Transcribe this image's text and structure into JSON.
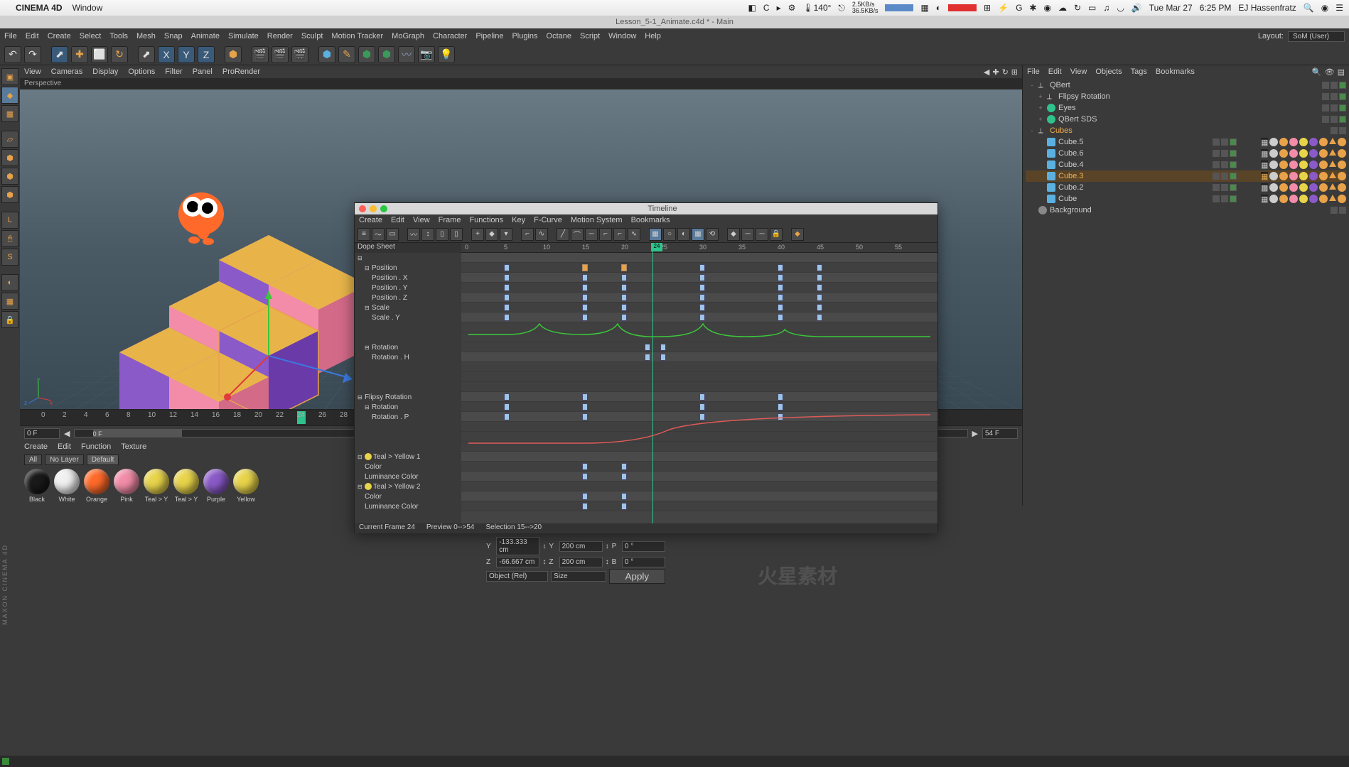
{
  "mac": {
    "app": "CINEMA 4D",
    "menu": "Window",
    "net_up": "2.5KB/s",
    "net_dn": "36.5KB/s",
    "temp": "140°",
    "date": "Tue Mar 27",
    "time": "6:25 PM",
    "user": "EJ Hassenfratz"
  },
  "titlebar": "Lesson_5-1_Animate.c4d * - Main",
  "main_menu": [
    "File",
    "Edit",
    "Create",
    "Select",
    "Tools",
    "Mesh",
    "Snap",
    "Animate",
    "Simulate",
    "Render",
    "Sculpt",
    "Motion Tracker",
    "MoGraph",
    "Character",
    "Pipeline",
    "Plugins",
    "Octane",
    "Script",
    "Window",
    "Help"
  ],
  "layout": {
    "label": "Layout:",
    "value": "SoM (User)"
  },
  "vp_menu": [
    "View",
    "Cameras",
    "Display",
    "Options",
    "Filter",
    "Panel",
    "ProRender"
  ],
  "vp_label": "Perspective",
  "om_menu": [
    "File",
    "Edit",
    "View",
    "Objects",
    "Tags",
    "Bookmarks"
  ],
  "objects": [
    {
      "name": "QBert",
      "lvl": 0,
      "icon": "null",
      "exp": "-"
    },
    {
      "name": "Flipsy Rotation",
      "lvl": 1,
      "icon": "null",
      "exp": "+"
    },
    {
      "name": "Eyes",
      "lvl": 1,
      "icon": "sphere",
      "exp": "+",
      "color": "#2fc28c"
    },
    {
      "name": "QBert SDS",
      "lvl": 1,
      "icon": "sds",
      "exp": "+",
      "color": "#2fc28c"
    },
    {
      "name": "Cubes",
      "lvl": 0,
      "icon": "null",
      "exp": "-",
      "sel": false,
      "hl": true
    },
    {
      "name": "Cube.5",
      "lvl": 1,
      "icon": "cube",
      "tags": true
    },
    {
      "name": "Cube.6",
      "lvl": 1,
      "icon": "cube",
      "tags": true
    },
    {
      "name": "Cube.4",
      "lvl": 1,
      "icon": "cube",
      "tags": true
    },
    {
      "name": "Cube.3",
      "lvl": 1,
      "icon": "cube",
      "tags": true,
      "sel": true
    },
    {
      "name": "Cube.2",
      "lvl": 1,
      "icon": "cube",
      "tags": true
    },
    {
      "name": "Cube",
      "lvl": 1,
      "icon": "cube",
      "tags": true
    },
    {
      "name": "Background",
      "lvl": 0,
      "icon": "bg"
    }
  ],
  "tag_colors": [
    "#ccc",
    "#e8a24a",
    "#f28ca8",
    "#e8d44a",
    "#8a5ac8",
    "#e8a24a"
  ],
  "timeline_ruler": [
    0,
    2,
    4,
    6,
    8,
    10,
    12,
    14,
    16,
    18,
    20,
    22,
    24,
    26,
    28
  ],
  "timeline_marker": 24,
  "frame_start": "0 F",
  "frame_mid": "0 F",
  "frame_end": "54 F",
  "mat_menu": [
    "Create",
    "Edit",
    "Function",
    "Texture"
  ],
  "mat_btns": [
    "All",
    "No Layer",
    "Default"
  ],
  "materials": [
    {
      "name": "Black",
      "color": "#1a1a1a"
    },
    {
      "name": "White",
      "color": "#f0f0f0"
    },
    {
      "name": "Orange",
      "color": "#ff6a2a"
    },
    {
      "name": "Pink",
      "color": "#f28ca8"
    },
    {
      "name": "Teal > Y",
      "color": "#e8d44a"
    },
    {
      "name": "Teal > Y",
      "color": "#e8d44a"
    },
    {
      "name": "Purple",
      "color": "#8a5ac8"
    },
    {
      "name": "Yellow",
      "color": "#e8d44a"
    }
  ],
  "coords": {
    "y": {
      "lbl": "Y",
      "pos": "-133.333 cm",
      "size": "200 cm",
      "rot": "0 °",
      "rlbl": "P"
    },
    "z": {
      "lbl": "Z",
      "pos": "-66.667 cm",
      "size": "200 cm",
      "rot": "0 °",
      "rlbl": "B"
    },
    "mode1": "Object (Rel)",
    "mode2": "Size",
    "apply": "Apply"
  },
  "timeline_window": {
    "title": "Timeline",
    "menu": [
      "Create",
      "Edit",
      "View",
      "Frame",
      "Functions",
      "Key",
      "F-Curve",
      "Motion System",
      "Bookmarks"
    ],
    "dope": "Dope Sheet",
    "ruler": [
      0,
      5,
      10,
      15,
      20,
      25,
      30,
      35,
      40,
      45,
      50,
      55
    ],
    "ruler_marker": 24,
    "tree": [
      {
        "name": "",
        "lvl": 0,
        "fold": "-"
      },
      {
        "name": "Position",
        "lvl": 1,
        "fold": "-"
      },
      {
        "name": "Position . X",
        "lvl": 2
      },
      {
        "name": "Position . Y",
        "lvl": 2
      },
      {
        "name": "Position . Z",
        "lvl": 2
      },
      {
        "name": "Scale",
        "lvl": 1,
        "fold": "-"
      },
      {
        "name": "Scale . Y",
        "lvl": 2
      },
      {
        "name": "",
        "lvl": 0,
        "spacer": 2
      },
      {
        "name": "Rotation",
        "lvl": 1,
        "fold": "-"
      },
      {
        "name": "Rotation . H",
        "lvl": 2
      },
      {
        "name": "",
        "lvl": 0,
        "spacer": 3
      },
      {
        "name": "Flipsy Rotation",
        "lvl": 0,
        "fold": "-"
      },
      {
        "name": "Rotation",
        "lvl": 1,
        "fold": "-"
      },
      {
        "name": "Rotation . P",
        "lvl": 2
      },
      {
        "name": "",
        "lvl": 0,
        "spacer": 3
      },
      {
        "name": "Teal > Yellow 1",
        "lvl": 0,
        "fold": "-",
        "mat": "#e8d44a"
      },
      {
        "name": "Color",
        "lvl": 1
      },
      {
        "name": "Luminance Color",
        "lvl": 1
      },
      {
        "name": "Teal > Yellow 2",
        "lvl": 0,
        "fold": "-",
        "mat": "#e8d44a"
      },
      {
        "name": "Color",
        "lvl": 1
      },
      {
        "name": "Luminance Color",
        "lvl": 1
      }
    ],
    "status": {
      "frame": "Current Frame  24",
      "preview": "Preview  0-->54",
      "sel": "Selection 15-->20"
    }
  },
  "vtext": "MAXON CINEMA 4D",
  "watermark": "火星素材"
}
